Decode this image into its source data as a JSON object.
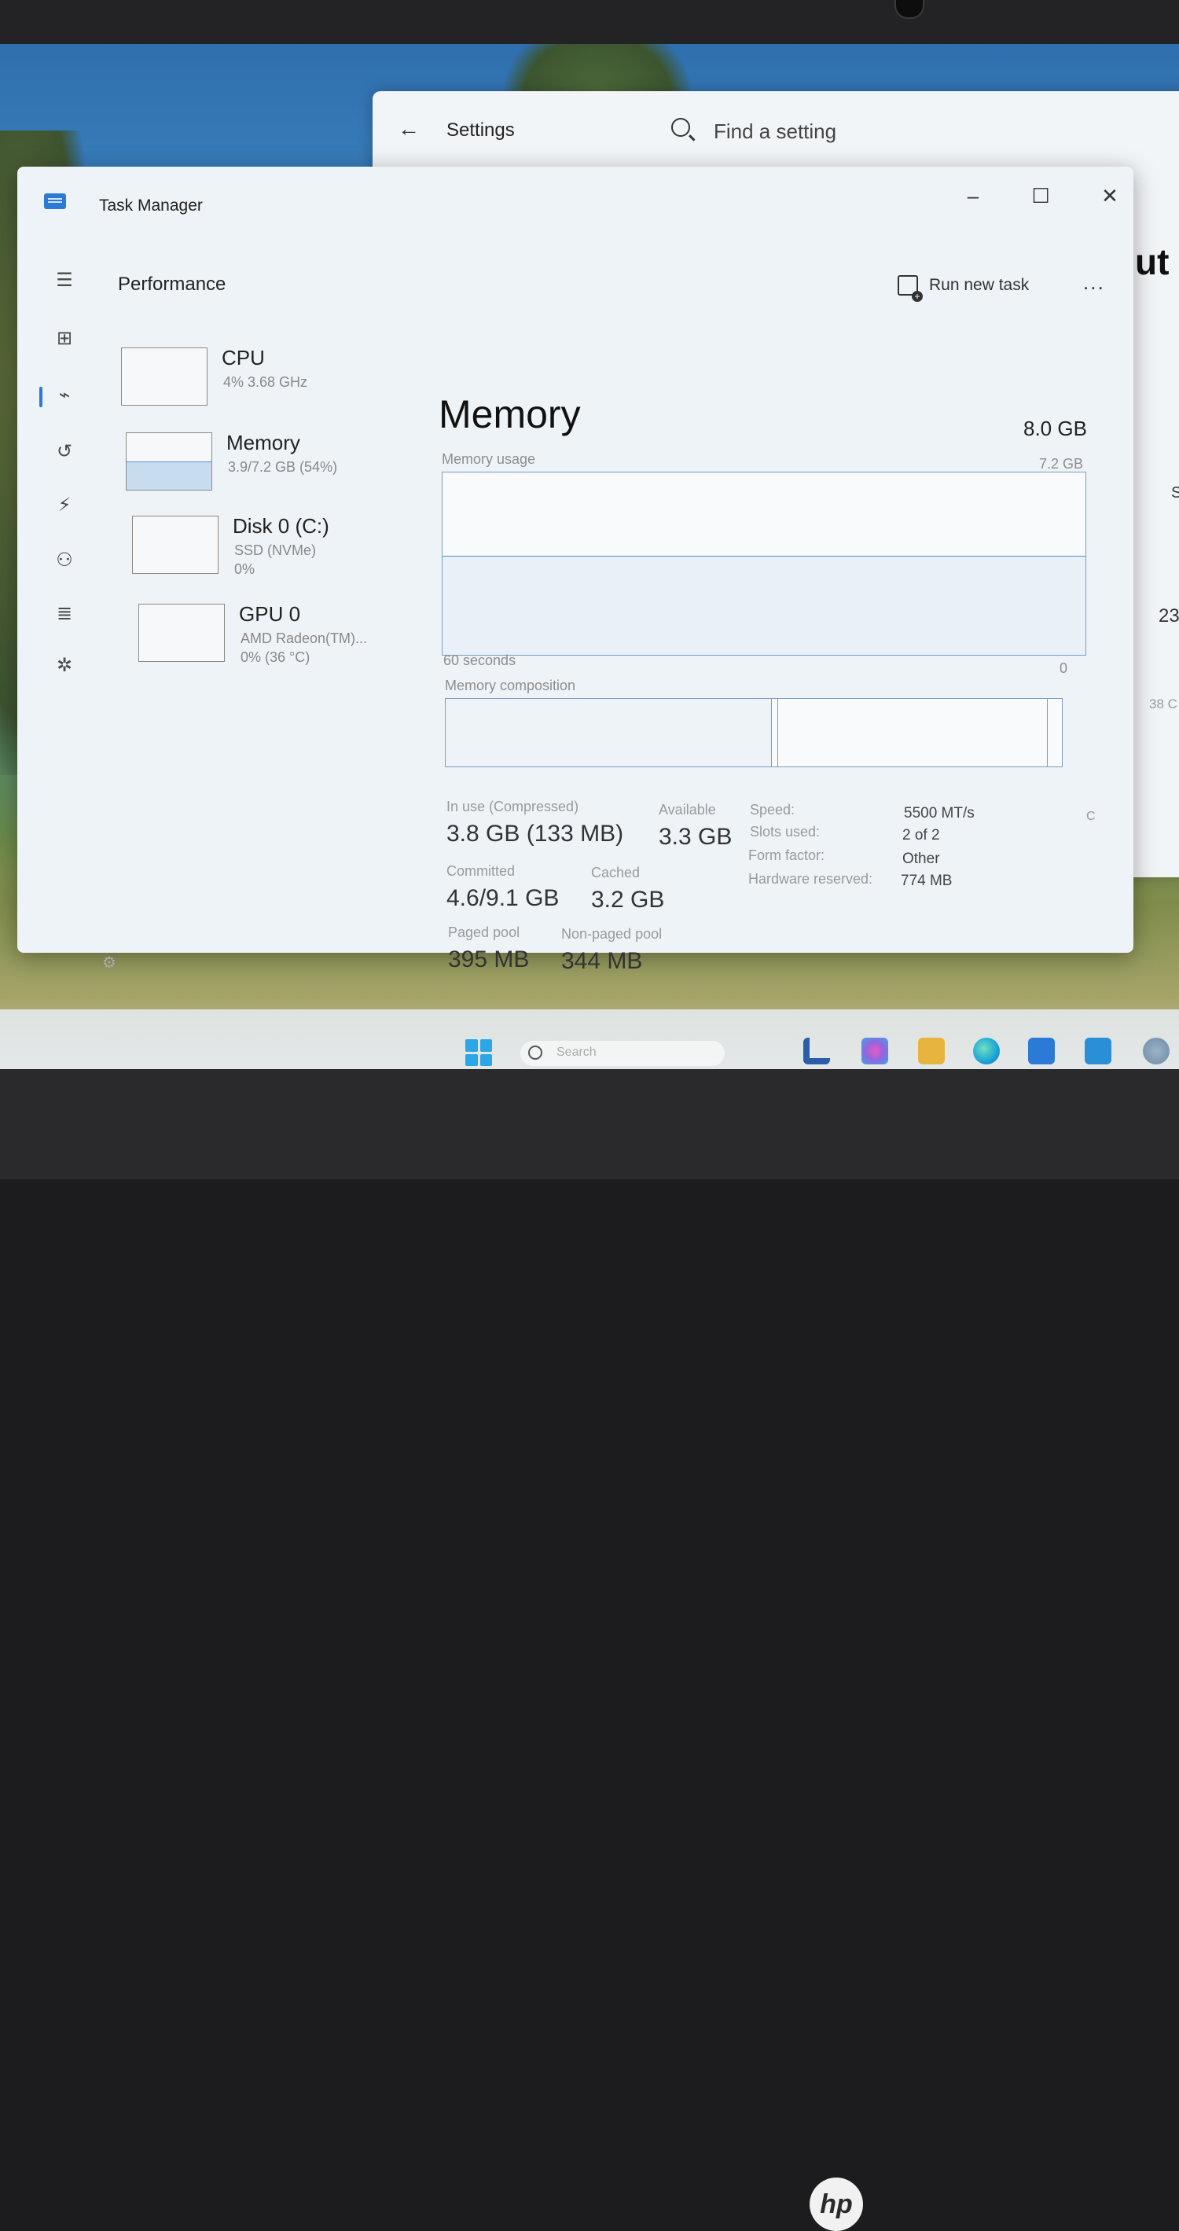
{
  "settings": {
    "title": "Settings",
    "search_placeholder": "Find a setting",
    "peek_title": "ut",
    "peek_1": "S",
    "peek_2": "23",
    "peek_3": "38 C",
    "peek_4": "C"
  },
  "task_manager": {
    "title": "Task Manager",
    "page_title": "Performance",
    "run_new_task": "Run new task",
    "more": "..."
  },
  "resources": [
    {
      "name": "CPU",
      "line1": "4% 3.68 GHz",
      "line2": ""
    },
    {
      "name": "Memory",
      "line1": "3.9/7.2 GB (54%)",
      "line2": ""
    },
    {
      "name": "Disk 0 (C:)",
      "line1": "SSD (NVMe)",
      "line2": "0%"
    },
    {
      "name": "GPU 0",
      "line1": "AMD Radeon(TM)...",
      "line2": "0% (36 °C)"
    }
  ],
  "memory": {
    "title": "Memory",
    "total": "8.0 GB",
    "usage_label": "Memory usage",
    "usage_max": "7.2 GB",
    "usage_fraction": 0.54,
    "time_label": "60 seconds",
    "time_min": "0",
    "composition_label": "Memory composition",
    "stats": {
      "in_use_label": "In use (Compressed)",
      "in_use": "3.8 GB (133 MB)",
      "available_label": "Available",
      "available": "3.3 GB",
      "committed_label": "Committed",
      "committed": "4.6/9.1 GB",
      "cached_label": "Cached",
      "cached": "3.2 GB",
      "paged_label": "Paged pool",
      "paged": "395 MB",
      "nonpaged_label": "Non-paged pool",
      "nonpaged": "344 MB"
    },
    "details": {
      "speed_label": "Speed:",
      "speed": "5500 MT/s",
      "slots_label": "Slots used:",
      "slots": "2 of 2",
      "form_label": "Form factor:",
      "form": "Other",
      "hw_label": "Hardware reserved:",
      "hw": "774 MB"
    }
  },
  "taskbar": {
    "search_placeholder": "Search"
  },
  "brand": {
    "logo": "hp"
  },
  "colors": {
    "accent": "#2b7bd6",
    "chart_border": "#7c9cc0"
  }
}
